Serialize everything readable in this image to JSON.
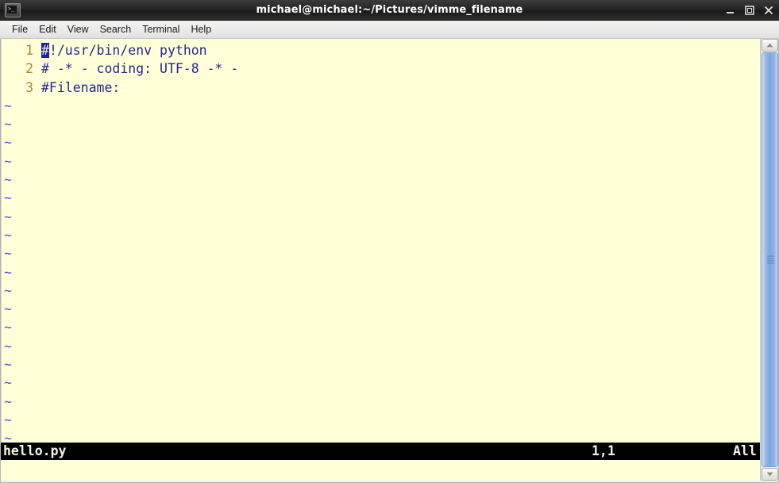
{
  "window": {
    "title": "michael@michael:~/Pictures/vimme_filename",
    "app_icon": "terminal-icon",
    "controls": {
      "minimize": "minimize-icon",
      "maximize": "maximize-icon",
      "close": "close-icon"
    }
  },
  "menubar": {
    "items": [
      {
        "label": "File"
      },
      {
        "label": "Edit"
      },
      {
        "label": "View"
      },
      {
        "label": "Search"
      },
      {
        "label": "Terminal"
      },
      {
        "label": "Help"
      }
    ]
  },
  "editor": {
    "lines": [
      {
        "number": "1",
        "cursor_char": "#",
        "text": "!/usr/bin/env python"
      },
      {
        "number": "2",
        "cursor_char": "",
        "text": "# -* - coding: UTF-8 -* -"
      },
      {
        "number": "3",
        "cursor_char": "",
        "text": "#Filename:"
      }
    ],
    "empty_marker": "~",
    "empty_marker_count": 19,
    "command_line": ""
  },
  "statusline": {
    "filename": "hello.py",
    "position": "1,1",
    "scroll": "All"
  },
  "scrollbar": {
    "up_arrow": "scroll-up-arrow-icon",
    "down_arrow": "scroll-down-arrow-icon",
    "thumb": "scrollbar-thumb"
  },
  "colors": {
    "background": "#ffffd8",
    "text": "#262691",
    "linenumber": "#a08a34",
    "tilde": "#5a4fd6",
    "cursor_bg": "#21219c",
    "statusline_bg": "#000000",
    "statusline_fg": "#f3f3e0",
    "titlebar_bg": "#252525",
    "scrollbar_thumb": "#7ea5e0"
  }
}
